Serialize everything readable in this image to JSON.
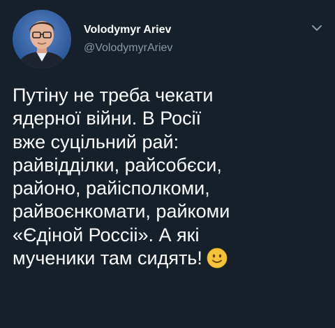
{
  "author": {
    "name": "Volodymyr Ariev",
    "handle": "@VolodymyrAriev"
  },
  "tweet": {
    "lines": [
      "Путіну не треба чекати",
      "ядерної війни. В Росії",
      "вже суцільний рай:",
      "райвідділки, райсобєси,",
      "районо, райісполкоми,",
      "райвоєнкомати, райкоми",
      "«Єдіной Россіі». А які",
      "мученики там сидять!"
    ],
    "emoji": "slightly-smiling-face"
  },
  "icons": {
    "menu": "chevron-down-icon"
  },
  "colors": {
    "background": "#15202b",
    "secondary_text": "#8899a6",
    "emoji_yellow": "#f5c33b"
  }
}
